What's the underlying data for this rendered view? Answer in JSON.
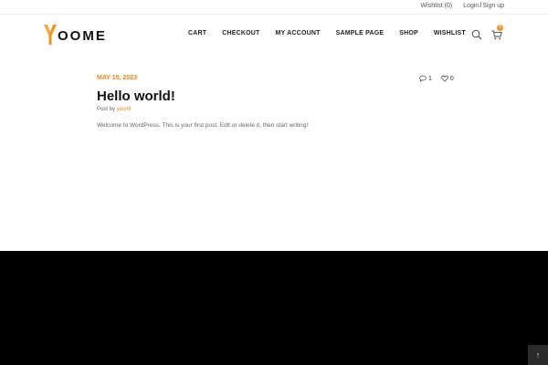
{
  "topbar": {
    "wishlist": "Wishlist (0)",
    "login": "Login",
    "separator": "/",
    "signup": "Sign up"
  },
  "logo": {
    "first_letter": "Y",
    "rest": "OOME",
    "accent_color": "#f5911e"
  },
  "nav": {
    "items": [
      "CART",
      "CHECKOUT",
      "MY ACCOUNT",
      "SAMPLE PAGE",
      "SHOP",
      "WISHLIST"
    ]
  },
  "header_icons": {
    "search": "search-icon",
    "cart": "cart-icon",
    "cart_count": "0"
  },
  "post": {
    "date": "MAY 15, 2023",
    "comments": "1",
    "likes": "0",
    "title": "Hello world!",
    "byline_prefix": "Post by",
    "author": "yusml",
    "excerpt": "Welcome to WordPress. This is your first post. Edit or delete it, then start writing!"
  },
  "footer": {
    "background": "#000000",
    "back_to_top": "↑"
  }
}
